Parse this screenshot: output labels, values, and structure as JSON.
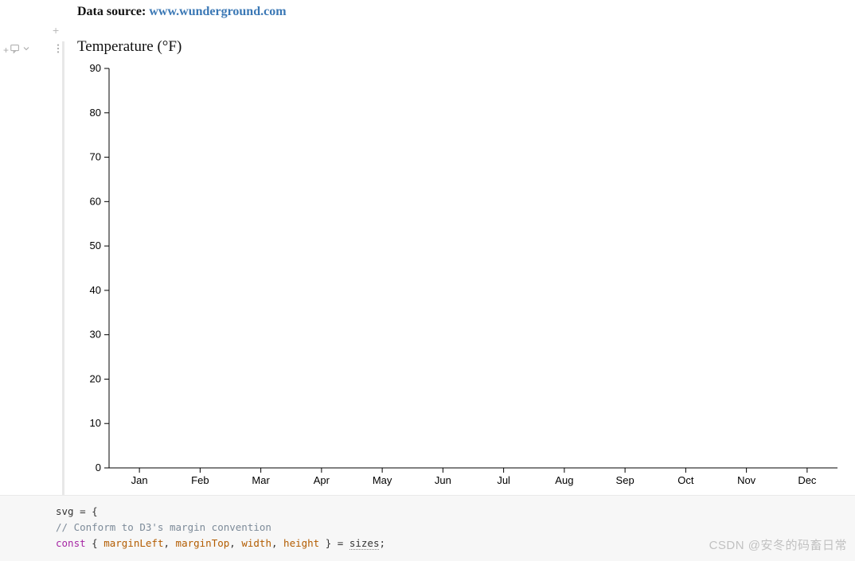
{
  "source": {
    "label": "Data source:",
    "link_text": "www.wunderground.com"
  },
  "gutter": {
    "add_cell_icon": "+",
    "add_above_icon": "+"
  },
  "chart_data": {
    "type": "line",
    "title": "Temperature (°F)",
    "xlabel": "",
    "ylabel": "",
    "categories": [
      "Jan",
      "Feb",
      "Mar",
      "Apr",
      "May",
      "Jun",
      "Jul",
      "Aug",
      "Sep",
      "Oct",
      "Nov",
      "Dec"
    ],
    "values": [],
    "xlim": [
      "Jan",
      "Dec"
    ],
    "ylim": [
      0,
      90
    ],
    "y_ticks": [
      0,
      10,
      20,
      30,
      40,
      50,
      60,
      70,
      80,
      90
    ]
  },
  "code": {
    "line1_var": "svg",
    "line1_rest": " = {",
    "line2": "  // Conform to D3's margin convention",
    "line3_kw": "  const",
    "line3_open": " { ",
    "line3_p1": "marginLeft",
    "line3_c1": ", ",
    "line3_p2": "marginTop",
    "line3_c2": ", ",
    "line3_p3": "width",
    "line3_c3": ", ",
    "line3_p4": "height",
    "line3_close": " } = ",
    "line3_ident": "sizes",
    "line3_semi": ";"
  },
  "watermark": "CSDN @安冬的码畜日常"
}
